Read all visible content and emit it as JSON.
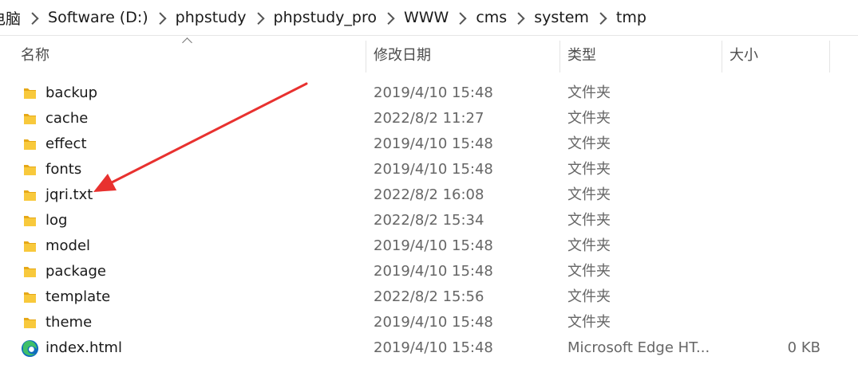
{
  "breadcrumb": [
    "电脑",
    "Software (D:)",
    "phpstudy",
    "phpstudy_pro",
    "WWW",
    "cms",
    "system",
    "tmp"
  ],
  "columns": {
    "name": "名称",
    "date": "修改日期",
    "type": "类型",
    "size": "大小"
  },
  "files": [
    {
      "name": "backup",
      "date": "2019/4/10 15:48",
      "type": "文件夹",
      "size": "",
      "icon": "folder-icon"
    },
    {
      "name": "cache",
      "date": "2022/8/2 11:27",
      "type": "文件夹",
      "size": "",
      "icon": "folder-icon"
    },
    {
      "name": "effect",
      "date": "2019/4/10 15:48",
      "type": "文件夹",
      "size": "",
      "icon": "folder-icon"
    },
    {
      "name": "fonts",
      "date": "2019/4/10 15:48",
      "type": "文件夹",
      "size": "",
      "icon": "folder-icon"
    },
    {
      "name": "jqri.txt",
      "date": "2022/8/2 16:08",
      "type": "文件夹",
      "size": "",
      "icon": "folder-icon"
    },
    {
      "name": "log",
      "date": "2022/8/2 15:34",
      "type": "文件夹",
      "size": "",
      "icon": "folder-icon"
    },
    {
      "name": "model",
      "date": "2019/4/10 15:48",
      "type": "文件夹",
      "size": "",
      "icon": "folder-icon"
    },
    {
      "name": "package",
      "date": "2019/4/10 15:48",
      "type": "文件夹",
      "size": "",
      "icon": "folder-icon"
    },
    {
      "name": "template",
      "date": "2022/8/2 15:56",
      "type": "文件夹",
      "size": "",
      "icon": "folder-icon"
    },
    {
      "name": "theme",
      "date": "2019/4/10 15:48",
      "type": "文件夹",
      "size": "",
      "icon": "folder-icon"
    },
    {
      "name": "index.html",
      "date": "2019/4/10 15:48",
      "type": "Microsoft Edge HT...",
      "size": "0 KB",
      "icon": "edge-icon"
    }
  ],
  "colors": {
    "folder": "#f8c93c",
    "folder_dark": "#e6a817",
    "annotation_arrow": "#e8312f",
    "edge_blue": "#0f6cbd",
    "edge_green": "#3fbf6a"
  }
}
